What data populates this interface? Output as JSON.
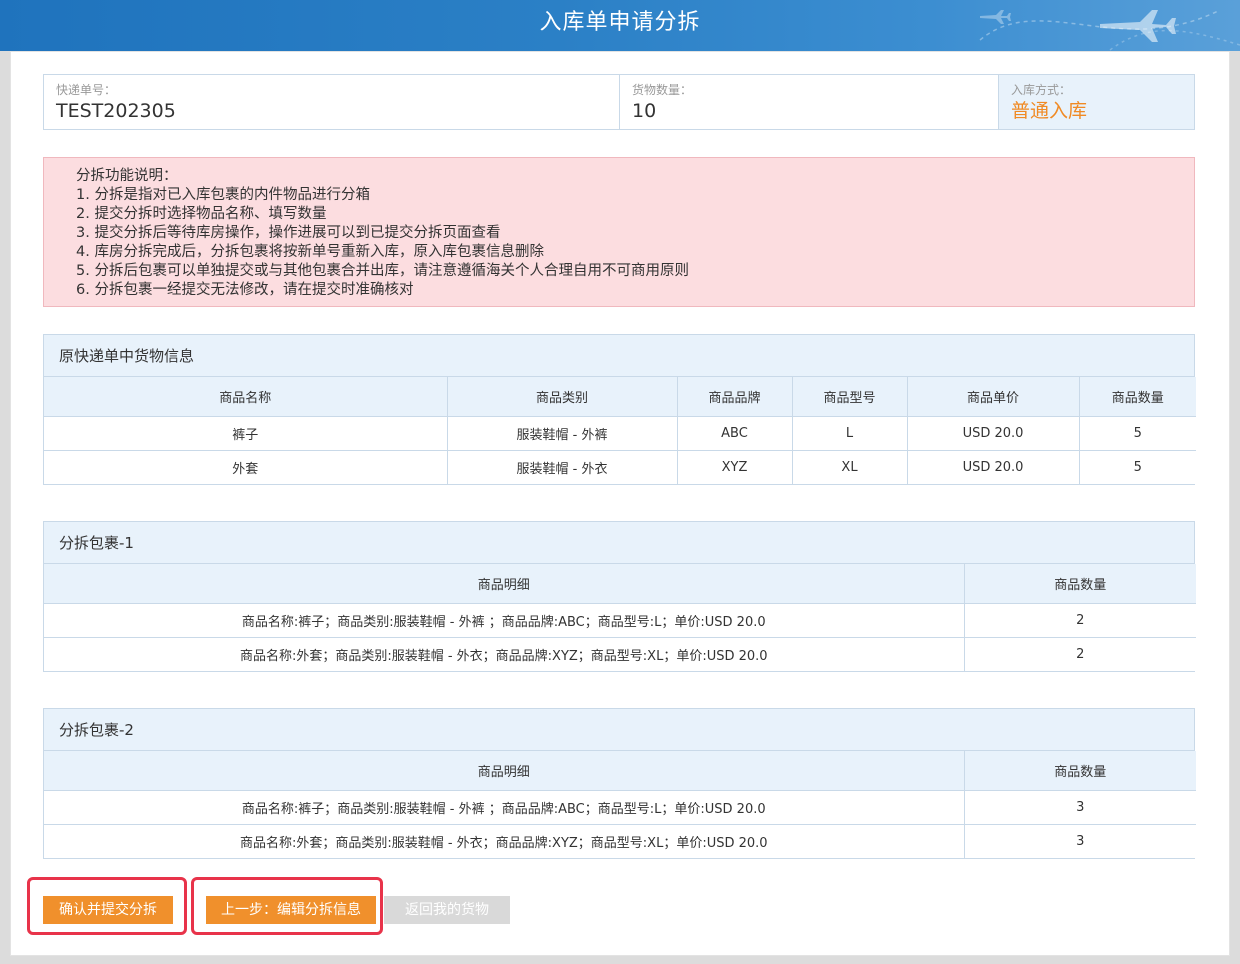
{
  "header": {
    "title": "入库单申请分拆"
  },
  "info": {
    "tracking_label": "快递单号：",
    "tracking_value": "TEST202305",
    "quantity_label": "货物数量：",
    "quantity_value": "10",
    "method_label": "入库方式：",
    "method_value": "普通入库"
  },
  "notice": {
    "title": "分拆功能说明：",
    "lines": [
      "1. 分拆是指对已入库包裹的内件物品进行分箱",
      "2. 提交分拆时选择物品名称、填写数量",
      "3. 提交分拆后等待库房操作，操作进展可以到已提交分拆页面查看",
      "4. 库房分拆完成后，分拆包裹将按新单号重新入库，原入库包裹信息删除",
      "5. 分拆后包裹可以单独提交或与其他包裹合并出库，请注意遵循海关个人合理自用不可商用原则",
      "6. 分拆包裹一经提交无法修改，请在提交时准确核对"
    ]
  },
  "original": {
    "title": "原快递单中货物信息",
    "columns": [
      "商品名称",
      "商品类别",
      "商品品牌",
      "商品型号",
      "商品单价",
      "商品数量"
    ],
    "rows": [
      [
        "裤子",
        "服装鞋帽 - 外裤",
        "ABC",
        "L",
        "USD 20.0",
        "5"
      ],
      [
        "外套",
        "服装鞋帽 - 外衣",
        "XYZ",
        "XL",
        "USD 20.0",
        "5"
      ]
    ]
  },
  "split1": {
    "title": "分拆包裹-1",
    "columns": [
      "商品明细",
      "商品数量"
    ],
    "rows": [
      [
        "商品名称:裤子；商品类别:服装鞋帽 - 外裤 ；商品品牌:ABC；商品型号:L；单价:USD 20.0",
        "2"
      ],
      [
        "商品名称:外套；商品类别:服装鞋帽 - 外衣；商品品牌:XYZ；商品型号:XL；单价:USD 20.0",
        "2"
      ]
    ]
  },
  "split2": {
    "title": "分拆包裹-2",
    "columns": [
      "商品明细",
      "商品数量"
    ],
    "rows": [
      [
        "商品名称:裤子；商品类别:服装鞋帽 - 外裤 ；商品品牌:ABC；商品型号:L；单价:USD 20.0",
        "3"
      ],
      [
        "商品名称:外套；商品类别:服装鞋帽 - 外衣；商品品牌:XYZ；商品型号:XL；单价:USD 20.0",
        "3"
      ]
    ]
  },
  "actions": {
    "confirm_label": "确认并提交分拆",
    "prev_label": "上一步：编辑分拆信息",
    "back_label": "返回我的货物"
  },
  "colors": {
    "header_blue": "#1f73bd",
    "accent_orange": "#f08a24",
    "notice_pink": "#fcdde0",
    "panel_blue": "#e8f2fb",
    "highlight_red": "#e8334a"
  }
}
